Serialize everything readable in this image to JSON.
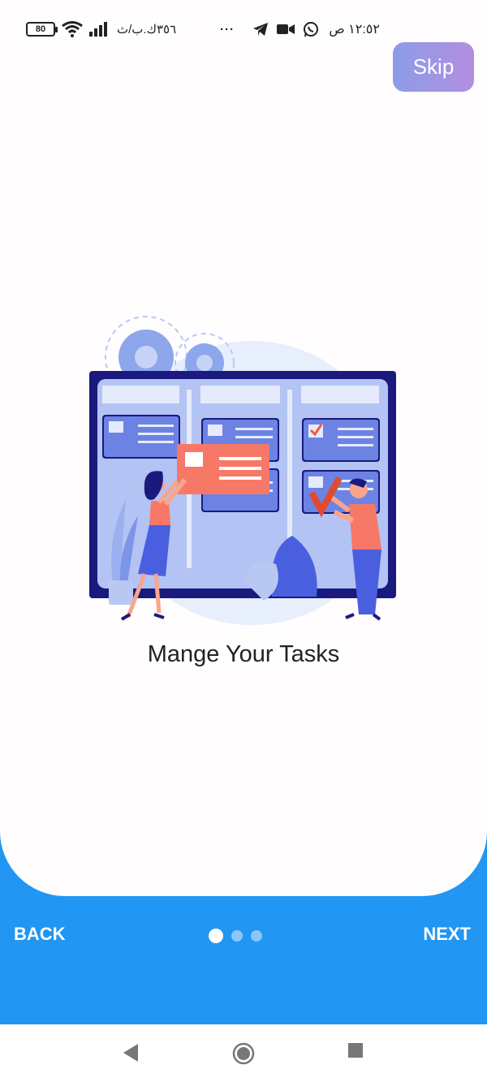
{
  "status_bar": {
    "battery": "80",
    "network_speed": "٣٥٦ك.ب/ث",
    "clock": "١٢:٥٢ ص",
    "more": "···"
  },
  "skip_label": "Skip",
  "page": {
    "title": "Mange Your Tasks"
  },
  "nav": {
    "back_label": "BACK",
    "next_label": "NEXT",
    "page_count": 3,
    "active_page": 1
  },
  "colors": {
    "primary_blue": "#2196f3",
    "skip_gradient_start": "#8c9ce8",
    "skip_gradient_end": "#b38ee0",
    "illustration_navy": "#1a1a7e",
    "illustration_coral": "#f77866"
  },
  "icons": [
    "battery-icon",
    "wifi-icon",
    "signal-icon",
    "telegram-icon",
    "video-icon",
    "whatsapp-icon",
    "back-triangle-icon",
    "home-circle-icon",
    "recents-square-icon"
  ]
}
